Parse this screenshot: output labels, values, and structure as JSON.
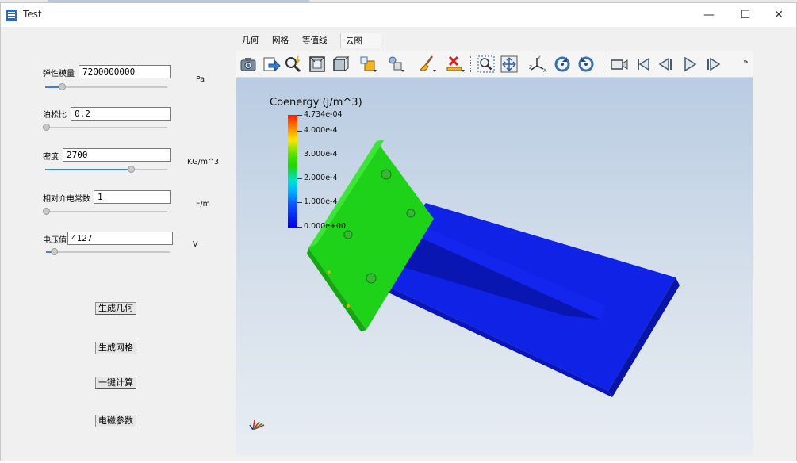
{
  "window": {
    "title": "Test",
    "minimize": "—",
    "maximize": "☐",
    "close": "✕"
  },
  "params": {
    "elastic_modulus": {
      "label": "弹性模量",
      "value": "7200000000",
      "unit": "Pa",
      "slider": 0.12
    },
    "poisson_ratio": {
      "label": "泊松比",
      "value": "0.2",
      "unit": "",
      "slider": 0.0
    },
    "density": {
      "label": "密度",
      "value": "2700",
      "unit": "KG/m^3",
      "slider": 0.72
    },
    "relative_permittivity": {
      "label": "相对介电常数",
      "value": "1",
      "unit": "F/m",
      "slider": 0.0
    },
    "voltage": {
      "label": "电压值",
      "value": "4127",
      "unit": "V",
      "slider": 0.04
    }
  },
  "buttons": {
    "gen_geometry": "生成几何",
    "gen_mesh": "生成网格",
    "compute": "一键计算",
    "em_params": "电磁参数"
  },
  "tabs": [
    {
      "label": "几何"
    },
    {
      "label": "网格"
    },
    {
      "label": "等值线"
    },
    {
      "label": "云图",
      "active": true
    }
  ],
  "toolbar": {
    "icons": [
      "camera-icon",
      "export-icon",
      "zoom-magic-icon",
      "fit-box-icon",
      "box-icon",
      "parts-icon",
      "light-icon",
      "clean-brush-icon",
      "clear-red-x-icon",
      "zoom-box-icon",
      "pan-icon",
      "axes-icon",
      "rotate-cw-icon",
      "rotate-ccw-icon",
      "video-icon",
      "first-frame-icon",
      "prev-frame-icon",
      "play-icon",
      "last-frame-icon"
    ],
    "more": "»"
  },
  "legend": {
    "title": "Coenergy (J/m^3)",
    "ticks": [
      "4.734e-04",
      "4.000e-4",
      "3.000e-4",
      "2.000e-4",
      "1.000e-4",
      "0.000e+00"
    ]
  },
  "colors": {
    "accent": "#3d7fd3",
    "model_low": "#0b1de0",
    "model_mid": "#1fd61a",
    "legend_top": "#ff1a00"
  }
}
